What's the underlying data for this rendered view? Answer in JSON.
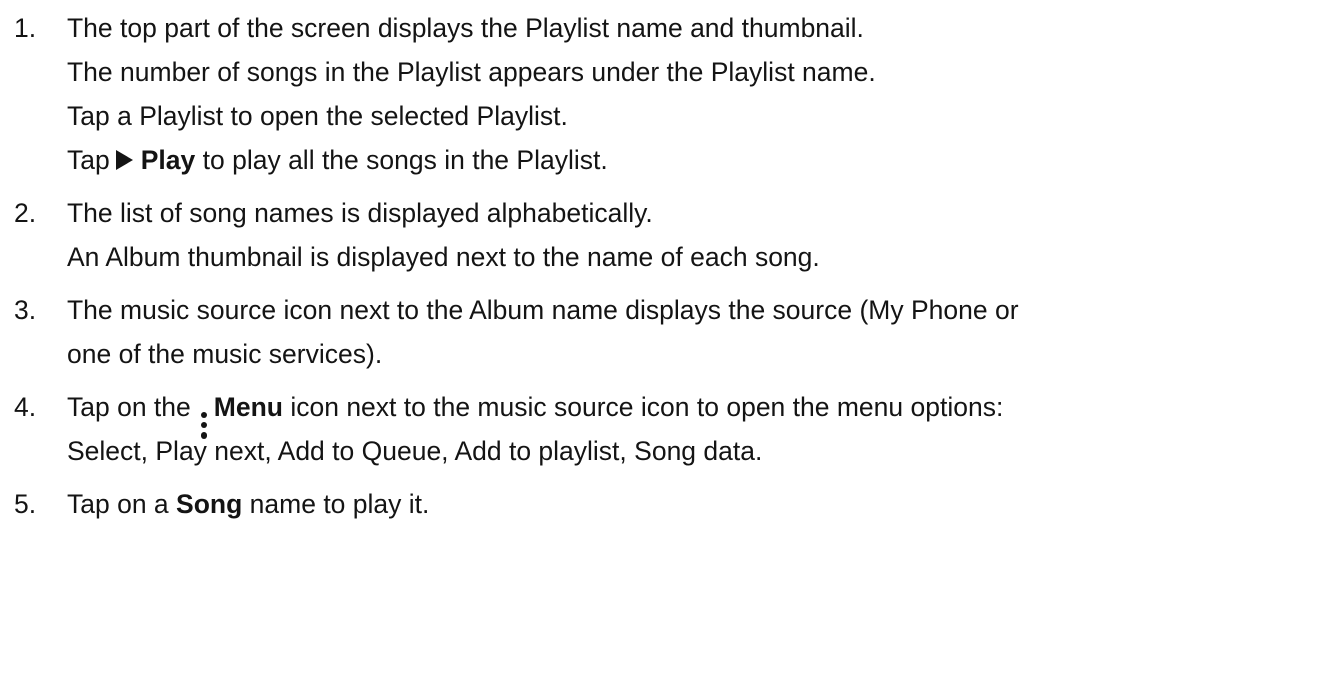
{
  "instructions": [
    {
      "number": "1.",
      "lines": [
        {
          "text": "The top part of the screen displays the Playlist name and thumbnail."
        },
        {
          "text": "The number of songs in the Playlist appears under the Playlist name."
        },
        {
          "text": "Tap a Playlist to open the selected Playlist."
        },
        {
          "before": "Tap",
          "icon": "play-icon",
          "bold": "Play",
          "after": "to play all the songs in the Playlist."
        }
      ]
    },
    {
      "number": "2.",
      "lines": [
        {
          "text": "The list of song names is displayed alphabetically."
        },
        {
          "text": "An Album thumbnail is displayed next to the name of each song."
        }
      ]
    },
    {
      "number": "3.",
      "lines": [
        {
          "text": "The music source icon next to the Album name displays the source (My Phone or"
        },
        {
          "text": "one of the music services)."
        }
      ]
    },
    {
      "number": "4.",
      "lines": [
        {
          "before": "Tap on the",
          "icon": "menu-icon",
          "bold": "Menu",
          "after": "icon next to the music source icon to open the menu options:"
        },
        {
          "text": "Select, Play next, Add to Queue, Add to playlist, Song data."
        }
      ]
    },
    {
      "number": "5.",
      "lines": [
        {
          "before": "Tap on a",
          "bold": "Song",
          "after": "name to play it."
        }
      ]
    }
  ]
}
